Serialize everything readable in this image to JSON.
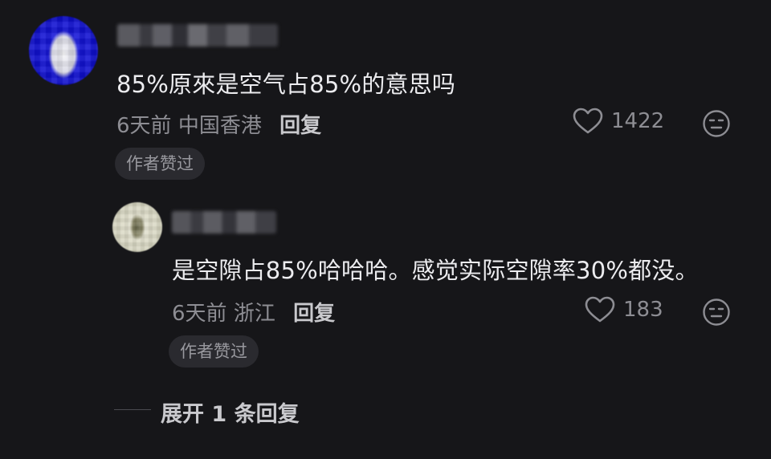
{
  "comment": {
    "text": "85%原來是空气占85%的意思吗",
    "time": "6天前",
    "location": "中国香港",
    "reply_label": "回复",
    "likes": "1422",
    "badge": "作者赞过"
  },
  "reply": {
    "text": "是空隙占85%哈哈哈。感觉实际空隙率30%都没。",
    "time": "6天前",
    "location": "浙江",
    "reply_label": "回复",
    "likes": "183",
    "badge": "作者赞过"
  },
  "expand": {
    "label": "展开 1 条回复"
  },
  "colors": {
    "background": "#161619",
    "primary_text": "#ececef",
    "secondary_text": "#8d8d93",
    "badge_bg": "#2a2a2f"
  }
}
